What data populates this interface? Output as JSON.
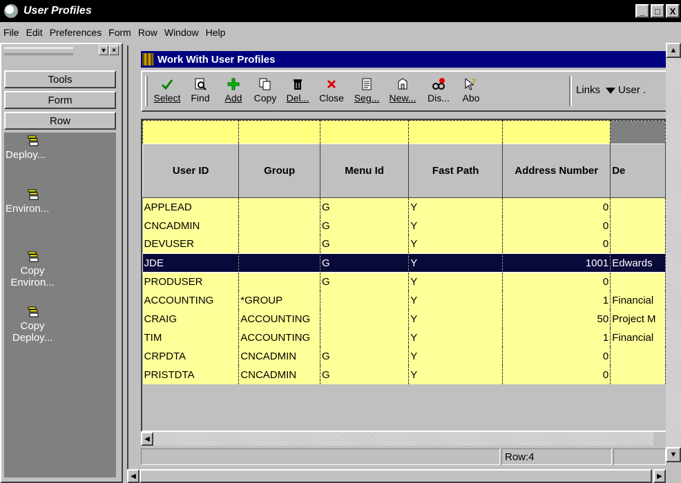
{
  "window": {
    "title": "User Profiles",
    "controls": [
      "_",
      "□",
      "X"
    ]
  },
  "menu": [
    "File",
    "Edit",
    "Preferences",
    "Form",
    "Row",
    "Window",
    "Help"
  ],
  "left_panel": {
    "tabs": [
      "Tools",
      "Form",
      "Row"
    ],
    "items": [
      "Deploy...",
      "Environ...",
      "Copy Environ...",
      "Copy Deploy..."
    ]
  },
  "form": {
    "title": "Work With User Profiles",
    "toolbar": [
      {
        "label": "Select",
        "icon": "checkmark-icon"
      },
      {
        "label": "Find",
        "icon": "find-icon"
      },
      {
        "label": "Add",
        "icon": "add-icon"
      },
      {
        "label": "Copy",
        "icon": "copy-icon"
      },
      {
        "label": "Del...",
        "icon": "trash-icon"
      },
      {
        "label": "Close",
        "icon": "close-icon"
      },
      {
        "label": "Seg...",
        "icon": "sequence-icon"
      },
      {
        "label": "New...",
        "icon": "new-icon"
      },
      {
        "label": "Dis...",
        "icon": "display-icon"
      },
      {
        "label": "Abo",
        "icon": "about-icon"
      }
    ],
    "links_label": "Links",
    "links_value": "User ."
  },
  "grid": {
    "columns": [
      "User ID",
      "Group",
      "Menu Id",
      "Fast Path",
      "Address Number",
      "De"
    ],
    "rows": [
      [
        "APPLEAD",
        "",
        "G",
        "Y",
        "0",
        ""
      ],
      [
        "CNCADMIN",
        "",
        "G",
        "Y",
        "0",
        ""
      ],
      [
        "DEVUSER",
        "",
        "G",
        "Y",
        "0",
        ""
      ],
      [
        "JDE",
        "",
        "G",
        "Y",
        "1001",
        "Edwards"
      ],
      [
        "PRODUSER",
        "",
        "G",
        "Y",
        "0",
        ""
      ],
      [
        "ACCOUNTING",
        "*GROUP",
        "",
        "Y",
        "1",
        "Financial"
      ],
      [
        "CRAIG",
        "ACCOUNTING",
        "",
        "Y",
        "50",
        "Project M"
      ],
      [
        "TIM",
        "ACCOUNTING",
        "",
        "Y",
        "1",
        "Financial"
      ],
      [
        "CRPDTA",
        "CNCADMIN",
        "G",
        "Y",
        "0",
        ""
      ],
      [
        "PRISTDTA",
        "CNCADMIN",
        "G",
        "Y",
        "0",
        ""
      ]
    ],
    "selected_row": 3
  },
  "status": {
    "row_text": "Row:4"
  }
}
